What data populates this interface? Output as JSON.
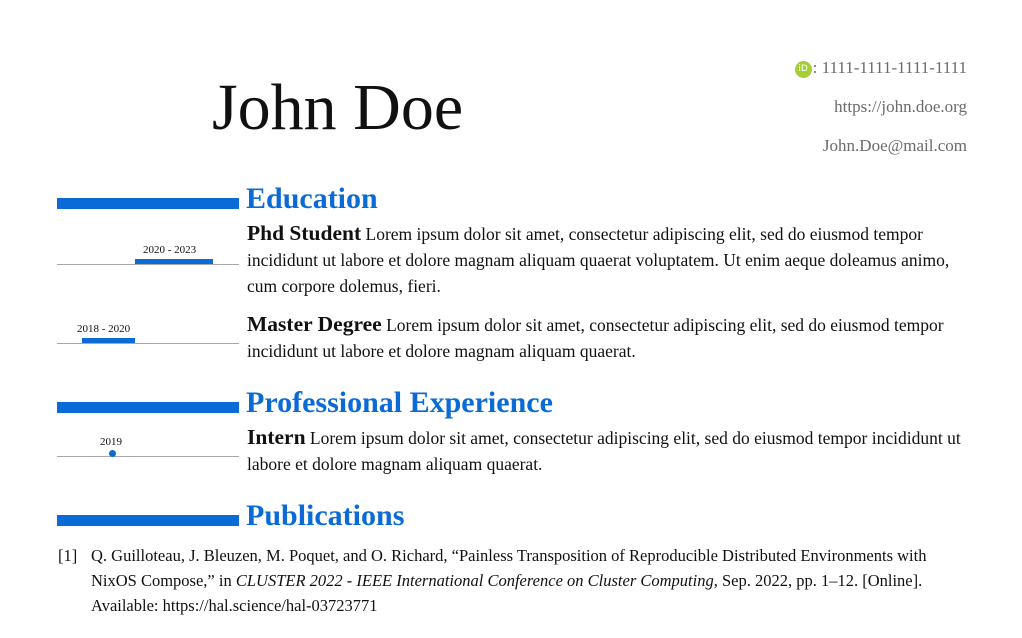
{
  "header": {
    "name": "John Doe",
    "orcid_icon_text": "iD",
    "orcid": ": 1111-1111-1111-1111",
    "website": "https://john.doe.org",
    "email": "John.Doe@mail.com"
  },
  "sections": {
    "education": {
      "title": "Education",
      "entries": [
        {
          "period": "2020 - 2023",
          "title": "Phd Student",
          "body": "Lorem ipsum dolor sit amet, consectetur adipiscing elit, sed do eiusmod tempor incididunt ut labore et dolore magnam aliquam quaerat voluptatem. Ut enim aeque doleamus animo, cum corpore dolemus, fieri."
        },
        {
          "period": "2018 - 2020",
          "title": "Master Degree",
          "body": "Lorem ipsum dolor sit amet, consectetur adipiscing elit, sed do eiusmod tempor incididunt ut labore et dolore magnam aliquam quaerat."
        }
      ]
    },
    "experience": {
      "title": "Professional Experience",
      "entries": [
        {
          "period": "2019",
          "title": "Intern",
          "body": "Lorem ipsum dolor sit amet, consectetur adipiscing elit, sed do eiusmod tempor incididunt ut labore et dolore magnam aliquam quaerat."
        }
      ]
    },
    "publications": {
      "title": "Publications",
      "items": [
        {
          "number": "[1]",
          "authors_title": "Q. Guilloteau, J. Bleuzen, M. Poquet, and O. Richard, “Painless Transposition of Reproducible Distributed Environments with NixOS Compose,” in ",
          "venue": "CLUSTER 2022 - IEEE International Conference on Cluster Computing",
          "details": ", Sep. 2022, pp. 1–12. [Online].  Available: https://hal.science/hal-03723771"
        }
      ]
    }
  },
  "colors": {
    "accent": "#0a6bd6",
    "contact_text": "#6b6b6b",
    "orcid": "#a6ce39",
    "timeline_line": "#a8a8a8"
  }
}
